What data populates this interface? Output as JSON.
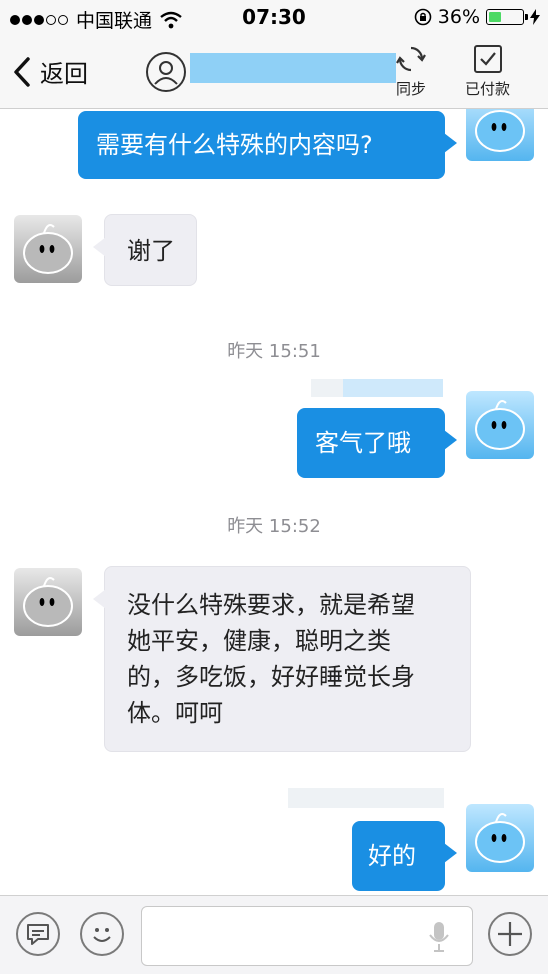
{
  "status_bar": {
    "carrier": "中国联通",
    "time": "07:30",
    "battery_percent": "36%"
  },
  "nav": {
    "back_label": "返回",
    "sync_label": "同步",
    "paid_label": "已付款"
  },
  "messages": [
    {
      "side": "out",
      "text": "需要有什么特殊的内容吗?"
    },
    {
      "side": "in",
      "text": "谢了"
    },
    {
      "timestamp": "昨天 15:51"
    },
    {
      "side": "out",
      "text": "客气了哦"
    },
    {
      "timestamp": "昨天 15:52"
    },
    {
      "side": "in",
      "lines": [
        "没什么特殊要求，就是希望",
        "她平安，健康，聪明之类",
        "的，多吃饭，好好睡觉长身",
        "体。呵呵"
      ]
    },
    {
      "side": "out",
      "text": "好的"
    }
  ],
  "colors": {
    "outgoing_bubble": "#1a8fe3",
    "incoming_bubble": "#eeeef3",
    "battery_fill": "#4cd964"
  },
  "icons": [
    "wifi-icon",
    "lock-rotation-icon",
    "charging-icon",
    "back-chevron-icon",
    "contact-avatar-icon",
    "sync-icon",
    "paid-checkbox-icon",
    "voice-message-icon",
    "emoji-icon",
    "microphone-icon",
    "add-icon"
  ]
}
